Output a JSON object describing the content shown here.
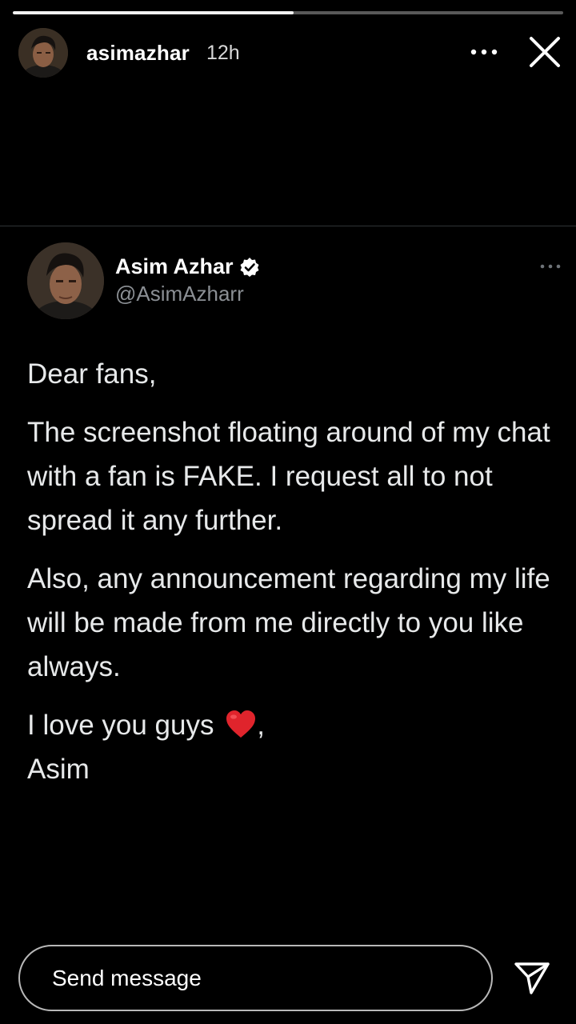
{
  "story": {
    "progress": 0.51,
    "username": "asimazhar",
    "time_ago": "12h"
  },
  "tweet": {
    "display_name": "Asim Azhar",
    "handle": "@AsimAzharr",
    "paragraphs": {
      "p1": "Dear fans,",
      "p2": "The screenshot floating around of my chat with a fan is FAKE. I request all to not spread it any further.",
      "p3": "Also, any announcement regarding my life will be made from me directly to you like always.",
      "p4_line1": "I love you guys",
      "p4_after_emoji": ",",
      "p4_line2": "Asim"
    },
    "verified_color": "#ffffff",
    "heart_color": "#e0242c"
  },
  "composer": {
    "placeholder": "Send message"
  },
  "icons": {
    "more": "more-horizontal-icon",
    "close": "close-icon",
    "send": "send-icon",
    "verified": "verified-badge-icon",
    "heart": "red-heart-emoji"
  }
}
